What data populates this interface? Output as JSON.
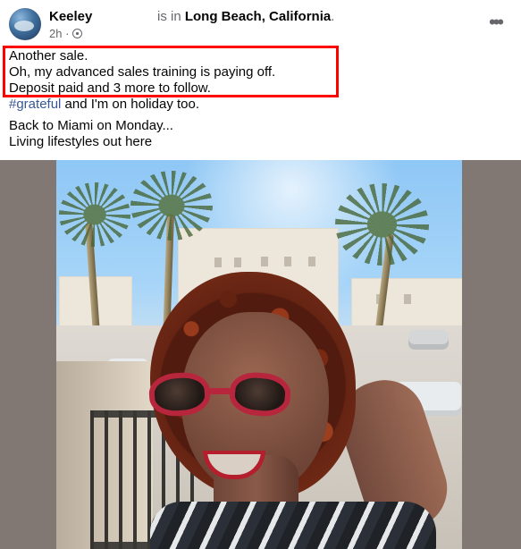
{
  "post": {
    "author": "Keeley",
    "location_prefix": "is in",
    "location": "Long Beach, California",
    "location_suffix": ".",
    "time": "2h",
    "meta_separator": "·",
    "more_icon": "horizontal-ellipsis-icon",
    "audience_icon": "globe-icon",
    "body_lines": [
      "Another sale.",
      "Oh, my advanced sales training is paying off.",
      "Deposit paid and 3 more to follow."
    ],
    "hashtag": "#grateful",
    "hashtag_tail": " and I'm on holiday too.",
    "after_lines": [
      "Back to Miami on Monday...",
      "Living lifestyles out here"
    ]
  },
  "colors": {
    "highlight": "#ff0000",
    "hashtag": "#385898",
    "meta": "#65676b"
  }
}
